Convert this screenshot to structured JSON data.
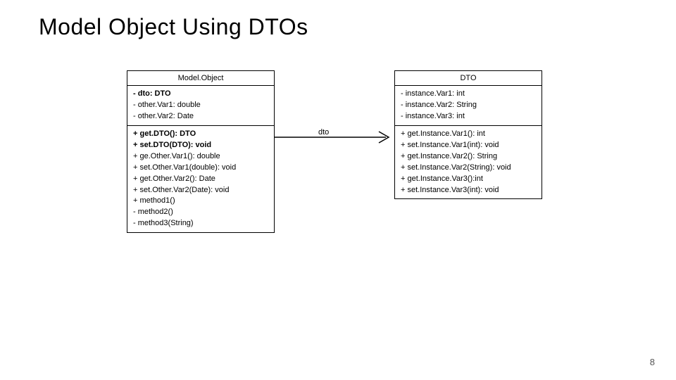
{
  "title": "Model Object Using DTOs",
  "page_number": "8",
  "arrow_label": "dto",
  "classes": {
    "model": {
      "name": "Model.Object",
      "attrs": [
        {
          "text": "- dto: DTO",
          "bold": true
        },
        {
          "text": "- other.Var1: double",
          "bold": false
        },
        {
          "text": "- other.Var2: Date",
          "bold": false
        }
      ],
      "ops": [
        {
          "text": "+ get.DTO(): DTO",
          "bold": true
        },
        {
          "text": "+ set.DTO(DTO): void",
          "bold": true
        },
        {
          "text": "+ ge.Other.Var1(): double",
          "bold": false
        },
        {
          "text": "+ set.Other.Var1(double): void",
          "bold": false
        },
        {
          "text": "+ get.Other.Var2(): Date",
          "bold": false
        },
        {
          "text": "+ set.Other.Var2(Date): void",
          "bold": false
        },
        {
          "text": "+ method1()",
          "bold": false
        },
        {
          "text": "- method2()",
          "bold": false
        },
        {
          "text": "- method3(String)",
          "bold": false
        }
      ]
    },
    "dto": {
      "name": "DTO",
      "attrs": [
        {
          "text": "- instance.Var1: int",
          "bold": false
        },
        {
          "text": "- instance.Var2: String",
          "bold": false
        },
        {
          "text": "- instance.Var3: int",
          "bold": false
        }
      ],
      "ops": [
        {
          "text": "+ get.Instance.Var1(): int",
          "bold": false
        },
        {
          "text": "+ set.Instance.Var1(int): void",
          "bold": false
        },
        {
          "text": "+ get.Instance.Var2(): String",
          "bold": false
        },
        {
          "text": "+ set.Instance.Var2(String): void",
          "bold": false
        },
        {
          "text": "+ get.Instance.Var3():int",
          "bold": false
        },
        {
          "text": "+ set.Instance.Var3(int): void",
          "bold": false
        }
      ]
    }
  }
}
